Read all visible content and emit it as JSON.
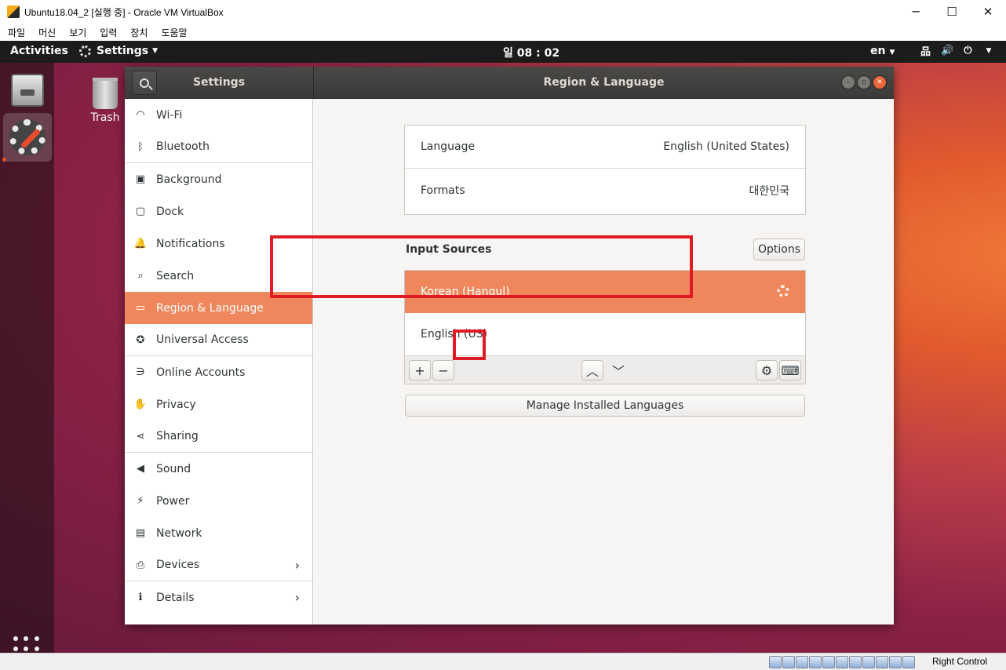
{
  "host": {
    "title": "Ubuntu18.04_2 [실행 중] - Oracle VM VirtualBox",
    "menu": [
      "파일",
      "머신",
      "보기",
      "입력",
      "장치",
      "도움말"
    ],
    "controls": {
      "minimize": "─",
      "maximize": "☐",
      "close": "✕"
    },
    "status": {
      "host_key": "Right Control"
    }
  },
  "topbar": {
    "activities": "Activities",
    "app_menu": "Settings",
    "clock": "일 08 : 02",
    "language": "en",
    "tray": {
      "network": "品",
      "volume": "🔊",
      "power": "⏻"
    }
  },
  "desktop": {
    "trash_label": "Trash"
  },
  "window": {
    "sidebar_title": "Settings",
    "panel_title": "Region & Language",
    "controls": {
      "minimize": "–",
      "maximize": "▫",
      "close": "✕"
    }
  },
  "sidebar": {
    "items": [
      {
        "label": "Wi-Fi",
        "icon": "wifi-icon",
        "glyph": "◠"
      },
      {
        "label": "Bluetooth",
        "icon": "bluetooth-icon",
        "glyph": "ᛒ"
      },
      {
        "label": "Background",
        "icon": "background-icon",
        "glyph": "▣"
      },
      {
        "label": "Dock",
        "icon": "dock-icon",
        "glyph": "▢"
      },
      {
        "label": "Notifications",
        "icon": "bell-icon",
        "glyph": "🔔"
      },
      {
        "label": "Search",
        "icon": "search-icon",
        "glyph": "⌕"
      },
      {
        "label": "Region & Language",
        "icon": "region-icon",
        "glyph": "▭"
      },
      {
        "label": "Universal Access",
        "icon": "accessibility-icon",
        "glyph": "✪"
      },
      {
        "label": "Online Accounts",
        "icon": "online-accounts-icon",
        "glyph": "∋"
      },
      {
        "label": "Privacy",
        "icon": "hand-icon",
        "glyph": "✋"
      },
      {
        "label": "Sharing",
        "icon": "share-icon",
        "glyph": "⋖"
      },
      {
        "label": "Sound",
        "icon": "speaker-icon",
        "glyph": "◀"
      },
      {
        "label": "Power",
        "icon": "power-plug-icon",
        "glyph": "⚡"
      },
      {
        "label": "Network",
        "icon": "network-icon",
        "glyph": "▤"
      },
      {
        "label": "Devices",
        "icon": "devices-icon",
        "glyph": "⎙"
      },
      {
        "label": "Details",
        "icon": "info-icon",
        "glyph": "ℹ"
      }
    ],
    "chevron": "›"
  },
  "region": {
    "language_label": "Language",
    "language_value": "English (United States)",
    "formats_label": "Formats",
    "formats_value": "대한민국",
    "input_sources_label": "Input Sources",
    "options_label": "Options",
    "input_sources": [
      "Korean (Hangul)",
      "English (US)"
    ],
    "toolbar": {
      "add": "+",
      "remove": "−",
      "up": "︿",
      "down": "﹀",
      "settings": "⚙",
      "keyboard": "⌨"
    },
    "manage_label": "Manage Installed Languages"
  }
}
